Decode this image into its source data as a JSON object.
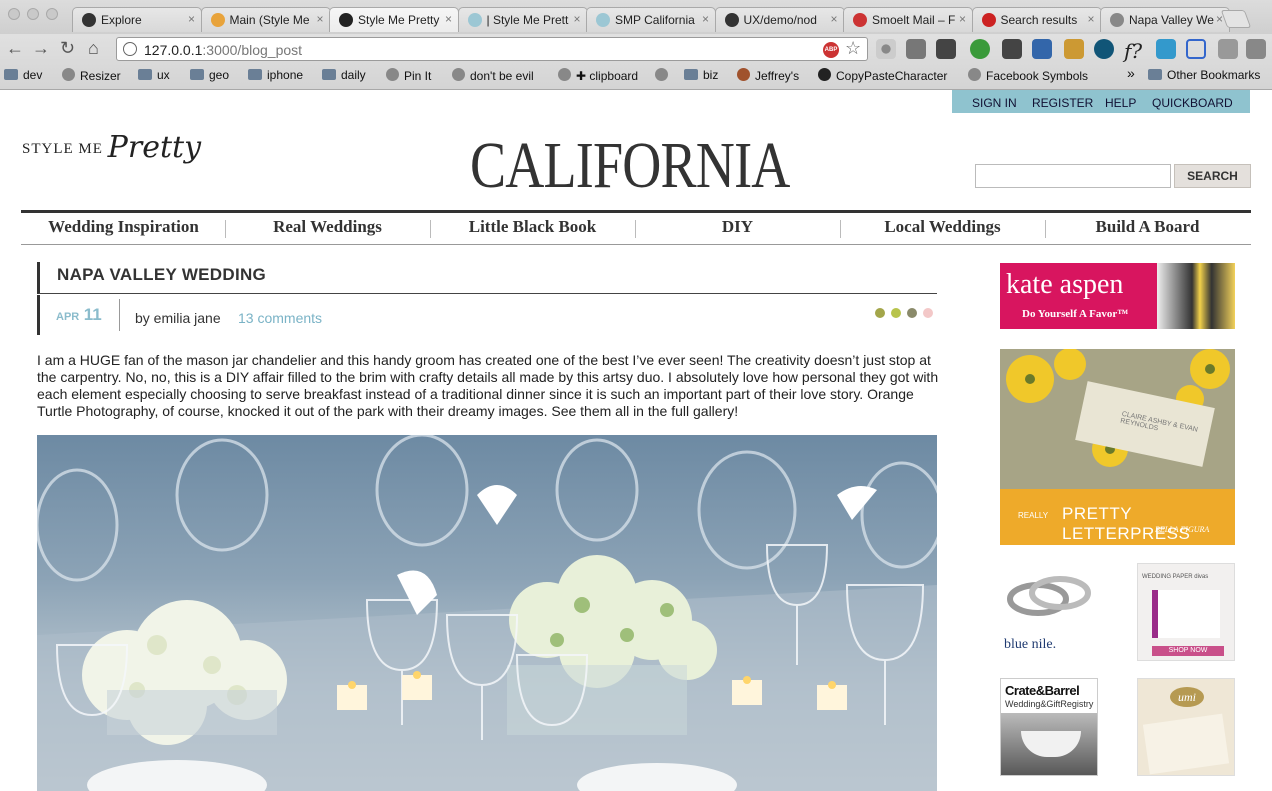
{
  "browser": {
    "tabs": [
      {
        "label": "Explore",
        "color": "#333333"
      },
      {
        "label": "Main (Style Me",
        "color": "#e8a33b"
      },
      {
        "label": "Style Me Pretty",
        "color": "#222222"
      },
      {
        "label": "| Style Me Prett",
        "color": "#9cc7d4"
      },
      {
        "label": "SMP California",
        "color": "#9cc7d4"
      },
      {
        "label": "UX/demo/nod",
        "color": "#333333"
      },
      {
        "label": "Smoelt Mail – F",
        "color": "#cc3333"
      },
      {
        "label": "Search results",
        "color": "#cc2222"
      },
      {
        "label": "Napa Valley We",
        "color": "#888888"
      }
    ],
    "url_host": "127.0.0.1",
    "url_path": ":3000/blog_post",
    "abp_label": "ABP",
    "bookmarks": [
      {
        "label": "dev",
        "kind": "folder"
      },
      {
        "label": "Resizer",
        "kind": "globe"
      },
      {
        "label": "ux",
        "kind": "folder"
      },
      {
        "label": "geo",
        "kind": "folder"
      },
      {
        "label": "iphone",
        "kind": "folder"
      },
      {
        "label": "daily",
        "kind": "folder"
      },
      {
        "label": "Pin It",
        "kind": "globe"
      },
      {
        "label": "don't be evil",
        "kind": "globe"
      },
      {
        "label": "✚ clipboard",
        "kind": "globe"
      },
      {
        "label": "",
        "kind": "globe"
      },
      {
        "label": "biz",
        "kind": "folder"
      },
      {
        "label": "Jeffrey's",
        "kind": "avatar"
      },
      {
        "label": "CopyPasteCharacter",
        "kind": "cursor"
      },
      {
        "label": "Facebook Symbols",
        "kind": "globe"
      }
    ],
    "more_bookmarks": "»",
    "other_bookmarks": "Other Bookmarks"
  },
  "site": {
    "topnav": [
      "SIGN IN",
      "REGISTER",
      "HELP",
      "QUICKBOARD"
    ],
    "logo_prefix": "STYLE ME",
    "logo_script": "Pretty",
    "section_title": "CALIFORNIA",
    "search_button": "SEARCH",
    "search_placeholder": "",
    "nav": [
      "Wedding Inspiration",
      "Real Weddings",
      "Little Black Book",
      "DIY",
      "Local Weddings",
      "Build A Board"
    ]
  },
  "post": {
    "title": "NAPA VALLEY WEDDING",
    "date_month": "APR",
    "date_day": "11",
    "author": "by emilia jane",
    "comments": "13 comments",
    "palette": [
      "#a3a64a",
      "#b8c44c",
      "#8a8a6a",
      "#f3c8c8"
    ],
    "body": "I am a HUGE fan of the mason jar chandelier and this handy groom has created one of the best I’ve ever seen! The creativity doesn’t just stop at the carpentry. No, no, this is a DIY affair filled to the brim with crafty details all made by this artsy duo. I absolutely love how personal they got with each element especially choosing to serve breakfast instead of a traditional dinner since it is such an important part of their love story. Orange Turtle Photography, of course, knocked it out of the park with their dreamy images. See them all in the full gallery!"
  },
  "ads": {
    "kate_aspen_brand": "kate aspen",
    "kate_aspen_tagline": "Do Yourself A Favor™",
    "letterpress_prefix": "REALLY",
    "letterpress_title": "PRETTY LETTERPRESS",
    "letterpress_sub": "BELLA FIGURA",
    "letterpress_card_text": "CLAIRE ASHBY & EVAN REYNOLDS",
    "blue_nile": "blue nile.",
    "wedding_paper_title": "WEDDING PAPER divas",
    "wedding_paper_button": "SHOP NOW",
    "crate_barrel": "Crate&Barrel",
    "crate_barrel_sub": "Wedding&GiftRegistry",
    "umi_logo": "umi"
  }
}
